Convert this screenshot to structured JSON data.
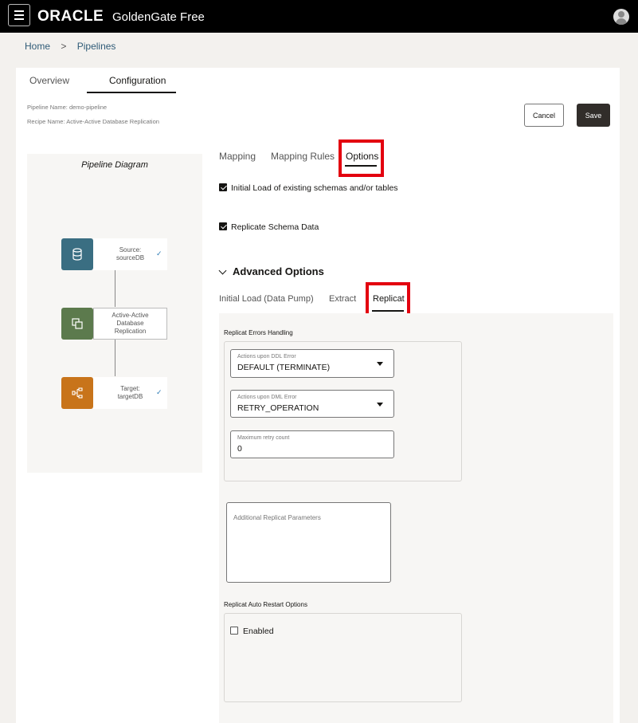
{
  "header": {
    "logo": "ORACLE",
    "product": "GoldenGate Free"
  },
  "breadcrumb": {
    "home": "Home",
    "separator": ">",
    "pipelines": "Pipelines"
  },
  "tabs": {
    "overview": "Overview",
    "configuration": "Configuration"
  },
  "meta": {
    "pipeline_name": "Pipeline Name: demo-pipeline",
    "recipe_name": "Recipe Name: Active-Active Database Replication"
  },
  "actions": {
    "cancel": "Cancel",
    "save": "Save"
  },
  "diagram": {
    "title": "Pipeline Diagram",
    "source_label": "Source:",
    "source_name": "sourceDB",
    "recipe_line1": "Active-Active",
    "recipe_line2": "Database",
    "recipe_line3": "Replication",
    "target_label": "Target:",
    "target_name": "targetDB",
    "check": "✓",
    "colors": {
      "source": "#3a6e82",
      "recipe": "#5c7a4d",
      "target": "#c8741a"
    }
  },
  "subtabs": {
    "mapping": "Mapping",
    "mapping_rules": "Mapping Rules",
    "options": "Options"
  },
  "options": {
    "initial_load": "Initial Load of existing schemas and/or tables",
    "initial_load_checked": true,
    "replicate_schema": "Replicate Schema Data",
    "replicate_schema_checked": true
  },
  "advanced": {
    "title": "Advanced Options",
    "tabs": {
      "initial_load": "Initial Load (Data Pump)",
      "extract": "Extract",
      "replicat": "Replicat"
    }
  },
  "replicat": {
    "errors_handling_label": "Replicat Errors Handling",
    "ddl_label": "Actions upon DDL Error",
    "ddl_value": "DEFAULT (TERMINATE)",
    "dml_label": "Actions upon DML Error",
    "dml_value": "RETRY_OPERATION",
    "retry_label": "Maximum retry count",
    "retry_value": "0",
    "additional_params_placeholder": "Additional Replicat Parameters",
    "auto_restart_label": "Replicat Auto Restart Options",
    "enabled_label": "Enabled",
    "enabled_checked": false
  },
  "highlight_color": "#e3000f"
}
